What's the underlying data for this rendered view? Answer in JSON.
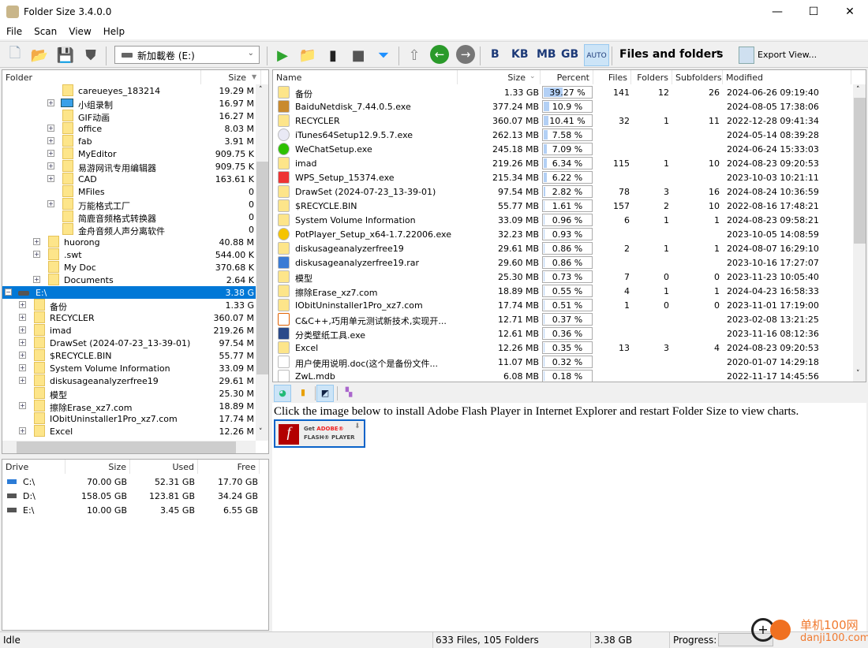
{
  "window": {
    "title": "Folder Size 3.4.0.0",
    "minimize": "—",
    "maximize": "☐",
    "close": "✕"
  },
  "menu": [
    "File",
    "Scan",
    "View",
    "Help"
  ],
  "toolbar": {
    "drive": "新加載卷 (E:)",
    "units": [
      "B",
      "KB",
      "MB",
      "GB",
      "AUTO"
    ],
    "view_mode": "Files and folders",
    "export": "Export View..."
  },
  "tree": {
    "headers": {
      "folder": "Folder",
      "size": "Size"
    },
    "rows": [
      {
        "level": 3,
        "name": "careueyes_183214",
        "size": "19.29 M",
        "exp": false
      },
      {
        "level": 3,
        "name": "小组录制",
        "size": "16.97 M",
        "exp": true,
        "icon": "monitor"
      },
      {
        "level": 3,
        "name": "GIF动画",
        "size": "16.27 M",
        "exp": false
      },
      {
        "level": 3,
        "name": "office",
        "size": "8.03 M",
        "exp": true
      },
      {
        "level": 3,
        "name": "fab",
        "size": "3.91 M",
        "exp": true
      },
      {
        "level": 3,
        "name": "MyEditor",
        "size": "909.75 K",
        "exp": true
      },
      {
        "level": 3,
        "name": "易游网讯专用编辑器",
        "size": "909.75 K",
        "exp": true
      },
      {
        "level": 3,
        "name": "CAD",
        "size": "163.61 K",
        "exp": true
      },
      {
        "level": 3,
        "name": "MFiles",
        "size": "0",
        "exp": false
      },
      {
        "level": 3,
        "name": "万能格式工厂",
        "size": "0",
        "exp": true
      },
      {
        "level": 3,
        "name": "简鹿音频格式转换器",
        "size": "0",
        "exp": false
      },
      {
        "level": 3,
        "name": "金舟音频人声分离软件",
        "size": "0",
        "exp": false
      },
      {
        "level": 2,
        "name": "huorong",
        "size": "40.88 M",
        "exp": true
      },
      {
        "level": 2,
        "name": ".swt",
        "size": "544.00 K",
        "exp": true
      },
      {
        "level": 2,
        "name": "My Doc",
        "size": "370.68 K",
        "exp": false
      },
      {
        "level": 2,
        "name": "Documents",
        "size": "2.64 K",
        "exp": true
      },
      {
        "level": 0,
        "name": "E:\\",
        "size": "3.38 G",
        "exp": "minus",
        "icon": "drive",
        "selected": true
      },
      {
        "level": 1,
        "name": "备份",
        "size": "1.33 G",
        "exp": true
      },
      {
        "level": 1,
        "name": "RECYCLER",
        "size": "360.07 M",
        "exp": true
      },
      {
        "level": 1,
        "name": "imad",
        "size": "219.26 M",
        "exp": true
      },
      {
        "level": 1,
        "name": "DrawSet (2024-07-23_13-39-01)",
        "size": "97.54 M",
        "exp": true
      },
      {
        "level": 1,
        "name": "$RECYCLE.BIN",
        "size": "55.77 M",
        "exp": true
      },
      {
        "level": 1,
        "name": "System Volume Information",
        "size": "33.09 M",
        "exp": true
      },
      {
        "level": 1,
        "name": "diskusageanalyzerfree19",
        "size": "29.61 M",
        "exp": true
      },
      {
        "level": 1,
        "name": "模型",
        "size": "25.30 M",
        "exp": false
      },
      {
        "level": 1,
        "name": "擦除Erase_xz7.com",
        "size": "18.89 M",
        "exp": true
      },
      {
        "level": 1,
        "name": "IObitUninstaller1Pro_xz7.com",
        "size": "17.74 M",
        "exp": false
      },
      {
        "level": 1,
        "name": "Excel",
        "size": "12.26 M",
        "exp": true
      }
    ]
  },
  "drives": {
    "headers": [
      "Drive",
      "Size",
      "Used",
      "Free"
    ],
    "rows": [
      [
        "C:\\",
        "70.00 GB",
        "52.31 GB",
        "17.70 GB"
      ],
      [
        "D:\\",
        "158.05 GB",
        "123.81 GB",
        "34.24 GB"
      ],
      [
        "E:\\",
        "10.00 GB",
        "3.45 GB",
        "6.55 GB"
      ]
    ]
  },
  "list": {
    "headers": [
      "Name",
      "Size",
      "Percent",
      "Files",
      "Folders",
      "Subfolders",
      "Modified"
    ],
    "rows": [
      {
        "icon": "folder",
        "name": "备份",
        "size": "1.33 GB",
        "pct": 39.27,
        "pct_text": "39.27 %",
        "files": "141",
        "folders": "12",
        "sub": "26",
        "mod": "2024-06-26 09:19:40"
      },
      {
        "icon": "baidu",
        "name": "BaiduNetdisk_7.44.0.5.exe",
        "size": "377.24 MB",
        "pct": 10.9,
        "pct_text": "10.9 %",
        "files": "",
        "folders": "",
        "sub": "",
        "mod": "2024-08-05 17:38:06"
      },
      {
        "icon": "folder",
        "name": "RECYCLER",
        "size": "360.07 MB",
        "pct": 10.41,
        "pct_text": "10.41 %",
        "files": "32",
        "folders": "1",
        "sub": "11",
        "mod": "2022-12-28 09:41:34"
      },
      {
        "icon": "itunes",
        "name": "iTunes64Setup12.9.5.7.exe",
        "size": "262.13 MB",
        "pct": 7.58,
        "pct_text": "7.58 %",
        "files": "",
        "folders": "",
        "sub": "",
        "mod": "2024-05-14 08:39:28"
      },
      {
        "icon": "wechat",
        "name": "WeChatSetup.exe",
        "size": "245.18 MB",
        "pct": 7.09,
        "pct_text": "7.09 %",
        "files": "",
        "folders": "",
        "sub": "",
        "mod": "2024-06-24 15:33:03"
      },
      {
        "icon": "folder",
        "name": "imad",
        "size": "219.26 MB",
        "pct": 6.34,
        "pct_text": "6.34 %",
        "files": "115",
        "folders": "1",
        "sub": "10",
        "mod": "2024-08-23 09:20:53"
      },
      {
        "icon": "wps",
        "name": "WPS_Setup_15374.exe",
        "size": "215.34 MB",
        "pct": 6.22,
        "pct_text": "6.22 %",
        "files": "",
        "folders": "",
        "sub": "",
        "mod": "2023-10-03 10:21:11"
      },
      {
        "icon": "folder",
        "name": "DrawSet (2024-07-23_13-39-01)",
        "size": "97.54 MB",
        "pct": 2.82,
        "pct_text": "2.82 %",
        "files": "78",
        "folders": "3",
        "sub": "16",
        "mod": "2024-08-24 10:36:59"
      },
      {
        "icon": "folder",
        "name": "$RECYCLE.BIN",
        "size": "55.77 MB",
        "pct": 1.61,
        "pct_text": "1.61 %",
        "files": "157",
        "folders": "2",
        "sub": "10",
        "mod": "2022-08-16 17:48:21"
      },
      {
        "icon": "folder",
        "name": "System Volume Information",
        "size": "33.09 MB",
        "pct": 0.96,
        "pct_text": "0.96 %",
        "files": "6",
        "folders": "1",
        "sub": "1",
        "mod": "2024-08-23 09:58:21"
      },
      {
        "icon": "potplayer",
        "name": "PotPlayer_Setup_x64-1.7.22006.exe",
        "size": "32.23 MB",
        "pct": 0.93,
        "pct_text": "0.93 %",
        "files": "",
        "folders": "",
        "sub": "",
        "mod": "2023-10-05 14:08:59"
      },
      {
        "icon": "folder",
        "name": "diskusageanalyzerfree19",
        "size": "29.61 MB",
        "pct": 0.86,
        "pct_text": "0.86 %",
        "files": "2",
        "folders": "1",
        "sub": "1",
        "mod": "2024-08-07 16:29:10"
      },
      {
        "icon": "rar",
        "name": "diskusageanalyzerfree19.rar",
        "size": "29.60 MB",
        "pct": 0.86,
        "pct_text": "0.86 %",
        "files": "",
        "folders": "",
        "sub": "",
        "mod": "2023-10-16 17:27:07"
      },
      {
        "icon": "folder",
        "name": "模型",
        "size": "25.30 MB",
        "pct": 0.73,
        "pct_text": "0.73 %",
        "files": "7",
        "folders": "0",
        "sub": "0",
        "mod": "2023-11-23 10:05:40"
      },
      {
        "icon": "folder",
        "name": "擦除Erase_xz7.com",
        "size": "18.89 MB",
        "pct": 0.55,
        "pct_text": "0.55 %",
        "files": "4",
        "folders": "1",
        "sub": "1",
        "mod": "2024-04-23 16:58:33"
      },
      {
        "icon": "folder",
        "name": "IObitUninstaller1Pro_xz7.com",
        "size": "17.74 MB",
        "pct": 0.51,
        "pct_text": "0.51 %",
        "files": "1",
        "folders": "0",
        "sub": "0",
        "mod": "2023-11-01 17:19:00"
      },
      {
        "icon": "pdf",
        "name": "C&C++,巧用单元测试新技术,实现开...",
        "size": "12.71 MB",
        "pct": 0.37,
        "pct_text": "0.37 %",
        "files": "",
        "folders": "",
        "sub": "",
        "mod": "2023-02-08 13:21:25"
      },
      {
        "icon": "app",
        "name": "分类壁纸工具.exe",
        "size": "12.61 MB",
        "pct": 0.36,
        "pct_text": "0.36 %",
        "files": "",
        "folders": "",
        "sub": "",
        "mod": "2023-11-16 08:12:36"
      },
      {
        "icon": "folder",
        "name": "Excel",
        "size": "12.26 MB",
        "pct": 0.35,
        "pct_text": "0.35 %",
        "files": "13",
        "folders": "3",
        "sub": "4",
        "mod": "2024-08-23 09:20:53"
      },
      {
        "icon": "file",
        "name": "用户使用说明.doc(这个是备份文件...",
        "size": "11.07 MB",
        "pct": 0.32,
        "pct_text": "0.32 %",
        "files": "",
        "folders": "",
        "sub": "",
        "mod": "2020-01-07 14:29:18"
      },
      {
        "icon": "file",
        "name": "ZwL.mdb",
        "size": "6.08 MB",
        "pct": 0.18,
        "pct_text": "0.18 %",
        "files": "",
        "folders": "",
        "sub": "",
        "mod": "2022-11-17 14:45:56"
      }
    ]
  },
  "chart": {
    "message": "Click the image below to install Adobe Flash Player in Internet Explorer and restart Folder Size to view charts.",
    "flash_get": "Get",
    "flash_adobe": "ADOBE®",
    "flash_player": "FLASH® PLAYER"
  },
  "status": {
    "state": "Idle",
    "counts": "633 Files, 105 Folders",
    "total": "3.38 GB",
    "progress_label": "Progress:"
  },
  "watermark": {
    "text1": "单机100网",
    "text2": "danji100.com"
  },
  "colors": {
    "selection": "#0078d7",
    "percent_bar": "#b3d0f5",
    "folder": "#fde58a"
  }
}
